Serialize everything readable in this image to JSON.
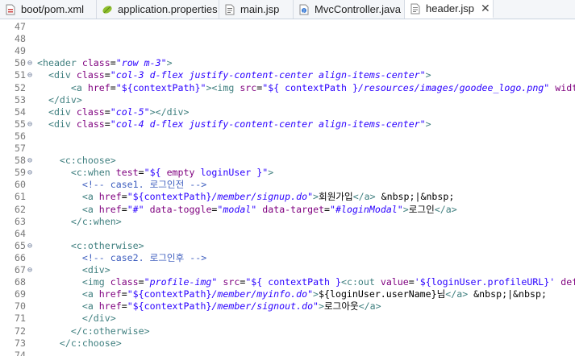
{
  "tabs": [
    {
      "label": "boot/pom.xml",
      "icon": "maven-file-icon"
    },
    {
      "label": "application.properties",
      "icon": "properties-file-icon"
    },
    {
      "label": "main.jsp",
      "icon": "jsp-file-icon"
    },
    {
      "label": "MvcController.java",
      "icon": "java-file-icon"
    },
    {
      "label": "header.jsp",
      "icon": "jsp-file-icon",
      "active": true,
      "close": "✕"
    }
  ],
  "lines": [
    {
      "n": "47",
      "fold": "",
      "s": []
    },
    {
      "n": "48",
      "fold": "",
      "s": []
    },
    {
      "n": "49",
      "fold": "",
      "s": []
    },
    {
      "n": "50",
      "fold": "⊖",
      "s": [
        [
          "t",
          "<header "
        ],
        [
          "a",
          "class"
        ],
        [
          "x",
          "="
        ],
        [
          "v",
          "\"row m-3\""
        ],
        [
          "t",
          ">"
        ]
      ]
    },
    {
      "n": "51",
      "fold": "⊖",
      "s": [
        [
          "x",
          "  "
        ],
        [
          "t",
          "<div "
        ],
        [
          "a",
          "class"
        ],
        [
          "x",
          "="
        ],
        [
          "v",
          "\"col-3 d-flex justify-content-center align-items-center\""
        ],
        [
          "t",
          ">"
        ]
      ]
    },
    {
      "n": "52",
      "fold": "",
      "s": [
        [
          "x",
          "      "
        ],
        [
          "t",
          "<a "
        ],
        [
          "a",
          "href"
        ],
        [
          "x",
          "="
        ],
        [
          "q",
          "\"${contextPath}\""
        ],
        [
          "t",
          "><img "
        ],
        [
          "a",
          "src"
        ],
        [
          "x",
          "="
        ],
        [
          "q",
          "\"${ contextPath }"
        ],
        [
          "v",
          "/resources/images/goodee_logo.png\""
        ],
        [
          "x",
          " "
        ],
        [
          "a",
          "width"
        ]
      ]
    },
    {
      "n": "53",
      "fold": "",
      "s": [
        [
          "x",
          "  "
        ],
        [
          "t",
          "</div>"
        ]
      ]
    },
    {
      "n": "54",
      "fold": "",
      "s": [
        [
          "x",
          "  "
        ],
        [
          "t",
          "<div "
        ],
        [
          "a",
          "class"
        ],
        [
          "x",
          "="
        ],
        [
          "v",
          "\"col-5\""
        ],
        [
          "t",
          "></div>"
        ]
      ]
    },
    {
      "n": "55",
      "fold": "⊖",
      "s": [
        [
          "x",
          "  "
        ],
        [
          "t",
          "<div "
        ],
        [
          "a",
          "class"
        ],
        [
          "x",
          "="
        ],
        [
          "v",
          "\"col-4 d-flex justify-content-center align-items-center\""
        ],
        [
          "t",
          ">"
        ]
      ]
    },
    {
      "n": "56",
      "fold": "",
      "s": []
    },
    {
      "n": "57",
      "fold": "",
      "s": []
    },
    {
      "n": "58",
      "fold": "⊖",
      "s": [
        [
          "x",
          "    "
        ],
        [
          "t",
          "<c:choose>"
        ]
      ]
    },
    {
      "n": "59",
      "fold": "⊖",
      "s": [
        [
          "x",
          "      "
        ],
        [
          "t",
          "<c:when "
        ],
        [
          "a",
          "test"
        ],
        [
          "x",
          "="
        ],
        [
          "q",
          "\"${ "
        ],
        [
          "e",
          "empty"
        ],
        [
          "q",
          " loginUser }\""
        ],
        [
          "t",
          ">"
        ]
      ]
    },
    {
      "n": "60",
      "fold": "",
      "s": [
        [
          "x",
          "        "
        ],
        [
          "c",
          "<!-- case1. 로그인전 -->"
        ]
      ]
    },
    {
      "n": "61",
      "fold": "",
      "s": [
        [
          "x",
          "        "
        ],
        [
          "t",
          "<a "
        ],
        [
          "a",
          "href"
        ],
        [
          "x",
          "="
        ],
        [
          "q",
          "\"${contextPath}"
        ],
        [
          "v",
          "/member/signup.do\""
        ],
        [
          "t",
          ">"
        ],
        [
          "x",
          "회원가입"
        ],
        [
          "t",
          "</a>"
        ],
        [
          "x",
          " &nbsp;|&nbsp;"
        ]
      ]
    },
    {
      "n": "62",
      "fold": "",
      "s": [
        [
          "x",
          "        "
        ],
        [
          "t",
          "<a "
        ],
        [
          "a",
          "href"
        ],
        [
          "x",
          "="
        ],
        [
          "v",
          "\"#\""
        ],
        [
          "x",
          " "
        ],
        [
          "a",
          "data-toggle"
        ],
        [
          "x",
          "="
        ],
        [
          "v",
          "\"modal\""
        ],
        [
          "x",
          " "
        ],
        [
          "a",
          "data-target"
        ],
        [
          "x",
          "="
        ],
        [
          "v",
          "\"#loginModal\""
        ],
        [
          "t",
          ">"
        ],
        [
          "x",
          "로그인"
        ],
        [
          "t",
          "</a>"
        ]
      ]
    },
    {
      "n": "63",
      "fold": "",
      "s": [
        [
          "x",
          "      "
        ],
        [
          "t",
          "</c:when>"
        ]
      ]
    },
    {
      "n": "64",
      "fold": "",
      "s": []
    },
    {
      "n": "65",
      "fold": "⊖",
      "s": [
        [
          "x",
          "      "
        ],
        [
          "t",
          "<c:otherwise>"
        ]
      ]
    },
    {
      "n": "66",
      "fold": "",
      "s": [
        [
          "x",
          "        "
        ],
        [
          "c",
          "<!-- case2. 로그인후 -->"
        ]
      ]
    },
    {
      "n": "67",
      "fold": "⊖",
      "s": [
        [
          "x",
          "        "
        ],
        [
          "t",
          "<div>"
        ]
      ]
    },
    {
      "n": "68",
      "fold": "",
      "s": [
        [
          "x",
          "        "
        ],
        [
          "t",
          "<img "
        ],
        [
          "a",
          "class"
        ],
        [
          "x",
          "="
        ],
        [
          "v",
          "\"profile-img\""
        ],
        [
          "x",
          " "
        ],
        [
          "a",
          "src"
        ],
        [
          "x",
          "="
        ],
        [
          "q",
          "\"${ contextPath }"
        ],
        [
          "t",
          "<c:out "
        ],
        [
          "a",
          "value"
        ],
        [
          "x",
          "="
        ],
        [
          "q",
          "'${loginUser.profileURL}'"
        ],
        [
          "x",
          " "
        ],
        [
          "a",
          "def"
        ]
      ]
    },
    {
      "n": "69",
      "fold": "",
      "s": [
        [
          "x",
          "        "
        ],
        [
          "t",
          "<a "
        ],
        [
          "a",
          "href"
        ],
        [
          "x",
          "="
        ],
        [
          "q",
          "\"${contextPath}"
        ],
        [
          "v",
          "/member/myinfo.do\""
        ],
        [
          "t",
          ">"
        ],
        [
          "x",
          "${loginUser.userName}님"
        ],
        [
          "t",
          "</a>"
        ],
        [
          "x",
          " &nbsp;|&nbsp;"
        ]
      ]
    },
    {
      "n": "70",
      "fold": "",
      "s": [
        [
          "x",
          "        "
        ],
        [
          "t",
          "<a "
        ],
        [
          "a",
          "href"
        ],
        [
          "x",
          "="
        ],
        [
          "q",
          "\"${contextPath}"
        ],
        [
          "v",
          "/member/signout.do\""
        ],
        [
          "t",
          ">"
        ],
        [
          "x",
          "로그아웃"
        ],
        [
          "t",
          "</a>"
        ]
      ]
    },
    {
      "n": "71",
      "fold": "",
      "s": [
        [
          "x",
          "        "
        ],
        [
          "t",
          "</div>"
        ]
      ]
    },
    {
      "n": "72",
      "fold": "",
      "s": [
        [
          "x",
          "      "
        ],
        [
          "t",
          "</c:otherwise>"
        ]
      ]
    },
    {
      "n": "73",
      "fold": "",
      "s": [
        [
          "x",
          "    "
        ],
        [
          "t",
          "</c:choose>"
        ]
      ]
    },
    {
      "n": "74",
      "fold": "",
      "s": []
    }
  ]
}
